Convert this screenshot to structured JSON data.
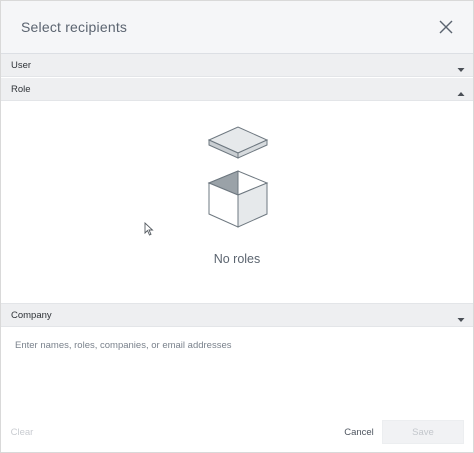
{
  "dialog": {
    "title": "Select recipients"
  },
  "sections": {
    "user": {
      "label": "User",
      "expanded": false
    },
    "role": {
      "label": "Role",
      "expanded": true,
      "empty_text": "No roles"
    },
    "company": {
      "label": "Company",
      "expanded": false
    }
  },
  "input": {
    "placeholder": "Enter names, roles, companies, or email addresses",
    "value": ""
  },
  "footer": {
    "clear_label": "Clear",
    "cancel_label": "Cancel",
    "save_label": "Save"
  },
  "icons": {
    "close": "close-icon",
    "chevron_down": "chevron-down-icon",
    "chevron_up": "chevron-up-icon",
    "empty_state": "empty-box-icon"
  },
  "colors": {
    "header_bg": "#f5f6f8",
    "section_bg": "#eeeff1",
    "save_disabled_bg": "#f1f2f4",
    "box_stroke": "#6e7880",
    "box_dark_face": "#9aa2a8",
    "box_light_face": "#e6e9eb"
  }
}
